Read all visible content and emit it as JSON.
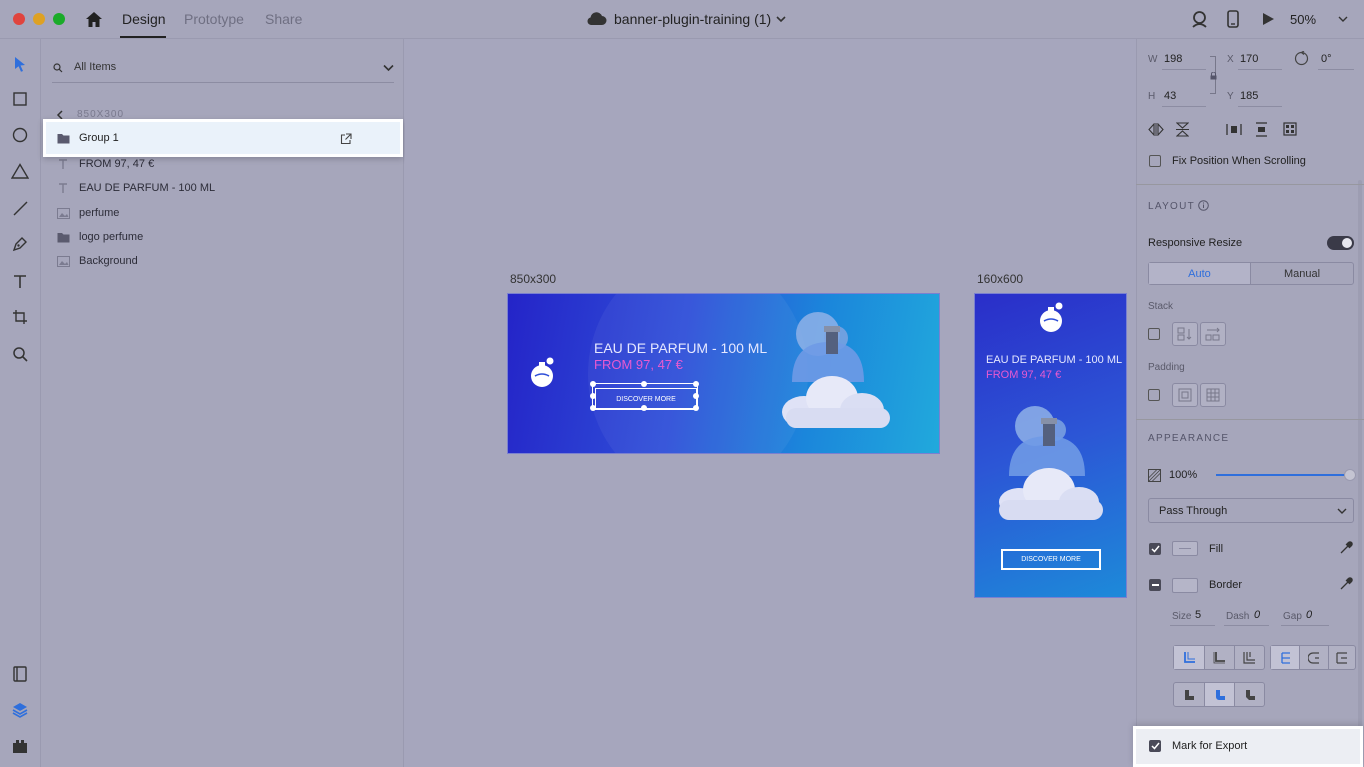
{
  "titlebar": {
    "tabs": [
      "Design",
      "Prototype",
      "Share"
    ],
    "doc_title": "banner-plugin-training (1)",
    "zoom": "50%",
    "traffic_colors": [
      "#e0443e",
      "#dea123",
      "#1aab29"
    ]
  },
  "toolbar": {
    "tools": [
      "select-icon",
      "rectangle-icon",
      "ellipse-icon",
      "polygon-icon",
      "line-icon",
      "pen-icon",
      "text-icon",
      "artboard-icon",
      "zoom-icon"
    ],
    "bottom": [
      "assets-icon",
      "layers-icon",
      "plugins-icon"
    ]
  },
  "layers": {
    "search_label": "All Items",
    "breadcrumb": "850X300",
    "items": [
      {
        "label": "Group 1",
        "icon": "folder-icon"
      },
      {
        "label": "FROM 97, 47 €",
        "icon": "text-layer-icon"
      },
      {
        "label": "EAU DE PARFUM - 100 ML",
        "icon": "text-layer-icon"
      },
      {
        "label": "perfume",
        "icon": "image-icon"
      },
      {
        "label": "logo perfume",
        "icon": "folder-icon"
      },
      {
        "label": "Background",
        "icon": "image-icon"
      }
    ]
  },
  "canvas": {
    "artboard1": {
      "label": "850x300",
      "heading": "EAU DE PARFUM - 100 ML",
      "price": "FROM 97, 47 €",
      "cta": "DISCOVER MORE"
    },
    "artboard2": {
      "label": "160x600",
      "heading": "EAU DE PARFUM - 100 ML",
      "price": "FROM 97, 47 €",
      "cta": "DISCOVER MORE"
    }
  },
  "properties": {
    "w_label": "W",
    "w": "198",
    "x_label": "X",
    "x": "170",
    "rotation": "0°",
    "h_label": "H",
    "h": "43",
    "y_label": "Y",
    "y": "185",
    "fix_position": "Fix Position When Scrolling",
    "layout_title": "LAYOUT",
    "responsive_resize": "Responsive Resize",
    "auto": "Auto",
    "manual": "Manual",
    "stack": "Stack",
    "padding": "Padding",
    "appearance_title": "APPEARANCE",
    "opacity": "100%",
    "blend_mode": "Pass Through",
    "fill": "Fill",
    "border": "Border",
    "size_label": "Size",
    "size": "5",
    "dash_label": "Dash",
    "dash": "0",
    "gap_label": "Gap",
    "gap": "0",
    "mark_for_export": "Mark for Export",
    "accent": "#2f6fdc"
  }
}
